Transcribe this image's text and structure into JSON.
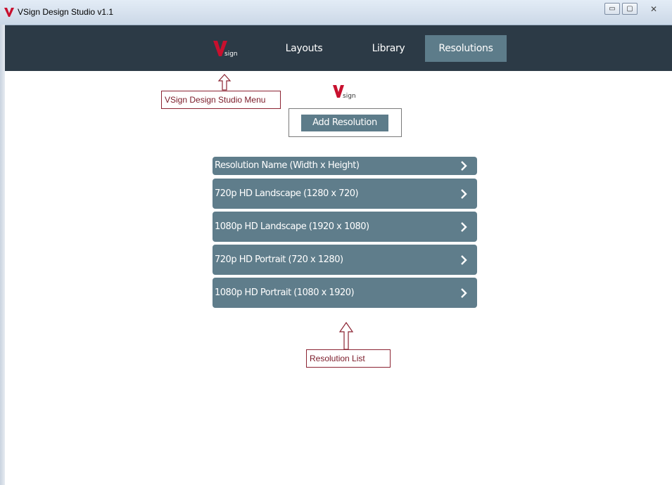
{
  "window": {
    "title": "VSign Design Studio v1.1",
    "controls": {
      "minimize": "▭",
      "maximize": "▢",
      "close": "✕"
    }
  },
  "nav": {
    "logo_letter": "V",
    "logo_text": "sign",
    "items": [
      {
        "label": "Layouts"
      },
      {
        "label": "Library"
      },
      {
        "label": "Resolutions",
        "active": true
      }
    ]
  },
  "annotations": {
    "menu_label": "VSign Design Studio Menu",
    "list_label": "Resolution List"
  },
  "center_logo": {
    "letter": "V",
    "text": "sign"
  },
  "add_resolution": {
    "label": "Add Resolution"
  },
  "resolutions": {
    "header": "Resolution Name (Width x Height)",
    "items": [
      {
        "label": "720p HD Landscape (1280 x 720)"
      },
      {
        "label": "1080p HD Landscape (1920 x 1080)"
      },
      {
        "label": "720p HD Portrait (720 x 1280)"
      },
      {
        "label": "1080p HD Portrait (1080 x 1920)"
      }
    ]
  },
  "colors": {
    "nav_bg": "#2c3a46",
    "accent": "#5d7c8a",
    "brand_red": "#c8102e",
    "callout_border": "#8b2332"
  }
}
